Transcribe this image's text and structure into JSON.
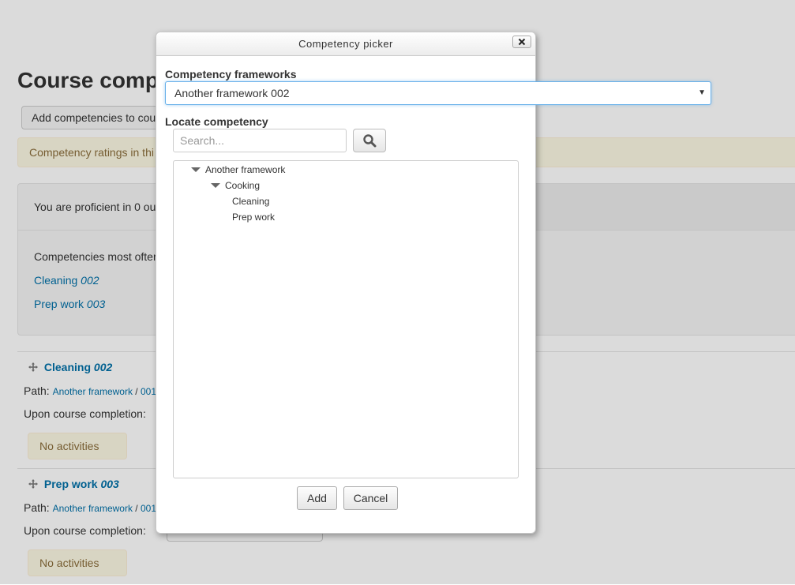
{
  "background": {
    "page_title": "Course comp",
    "add_button_label": "Add competencies to cou",
    "alert_text": "Competency ratings in thi",
    "summary": {
      "proficient_text": "You are proficient in 0 ou",
      "most_often_text": "Competencies most ofter",
      "links": [
        {
          "name": "Cleaning",
          "id": "002"
        },
        {
          "name": "Prep work",
          "id": "003"
        }
      ]
    },
    "competencies": [
      {
        "name": "Cleaning",
        "id": "002",
        "path_label": "Path:",
        "path_link": "Another framework",
        "path_sep": " / ",
        "path_rest": "001",
        "upon_label": "Upon course completion:",
        "no_activities": "No activities"
      },
      {
        "name": "Prep work",
        "id": "003",
        "path_label": "Path:",
        "path_link": "Another framework",
        "path_sep": " / ",
        "path_rest": "001",
        "upon_label": "Upon course completion:",
        "no_activities": "No activities"
      }
    ]
  },
  "dialog": {
    "title": "Competency picker",
    "frameworks_label": "Competency frameworks",
    "framework_selected": "Another framework 002",
    "locate_label": "Locate competency",
    "search_placeholder": "Search...",
    "tree": {
      "root": "Another framework",
      "child": "Cooking",
      "leaves": [
        "Cleaning",
        "Prep work"
      ]
    },
    "add_label": "Add",
    "cancel_label": "Cancel"
  },
  "colors": {
    "link": "#0070a8",
    "focus": "#66afe9",
    "alert_bg": "#fcf8e3"
  }
}
